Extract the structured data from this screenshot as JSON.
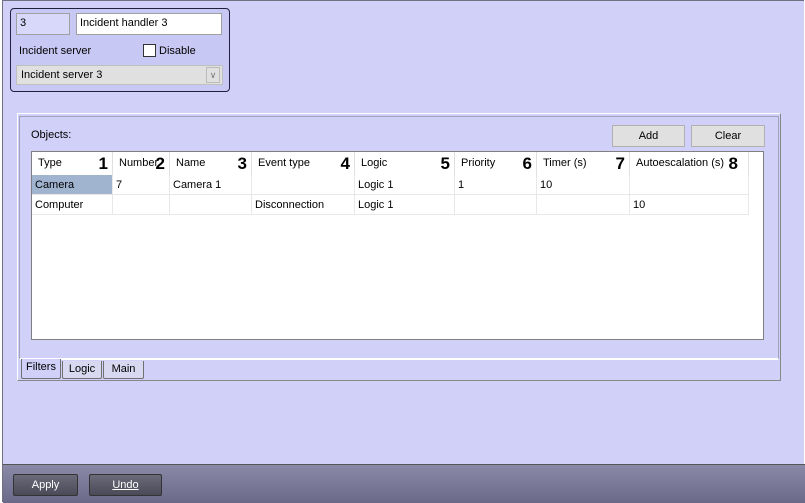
{
  "handler": {
    "id": "3",
    "name": "Incident handler 3",
    "server_label": "Incident server",
    "disable_label": "Disable",
    "disable_checked": false,
    "server_value": "Incident server 3"
  },
  "objects": {
    "label": "Objects:",
    "add_label": "Add",
    "clear_label": "Clear",
    "columns": [
      {
        "label": "Type",
        "marker": "1"
      },
      {
        "label": "Number",
        "marker": "2"
      },
      {
        "label": "Name",
        "marker": "3"
      },
      {
        "label": "Event type",
        "marker": "4"
      },
      {
        "label": "Logic",
        "marker": "5"
      },
      {
        "label": "Priority",
        "marker": "6"
      },
      {
        "label": "Timer (s)",
        "marker": "7"
      },
      {
        "label": "Autoescalation (s)",
        "marker": "8"
      }
    ],
    "rows": [
      [
        "Camera",
        "7",
        "Camera 1",
        "",
        "Logic 1",
        "1",
        "10",
        ""
      ],
      [
        "Computer",
        "",
        "",
        "Disconnection",
        "Logic 1",
        "",
        "",
        "10"
      ]
    ]
  },
  "tabs": [
    {
      "label": "Filters"
    },
    {
      "label": "Logic"
    },
    {
      "label": "Main"
    }
  ],
  "footer": {
    "apply_label": "Apply",
    "undo_label": "Undo"
  }
}
